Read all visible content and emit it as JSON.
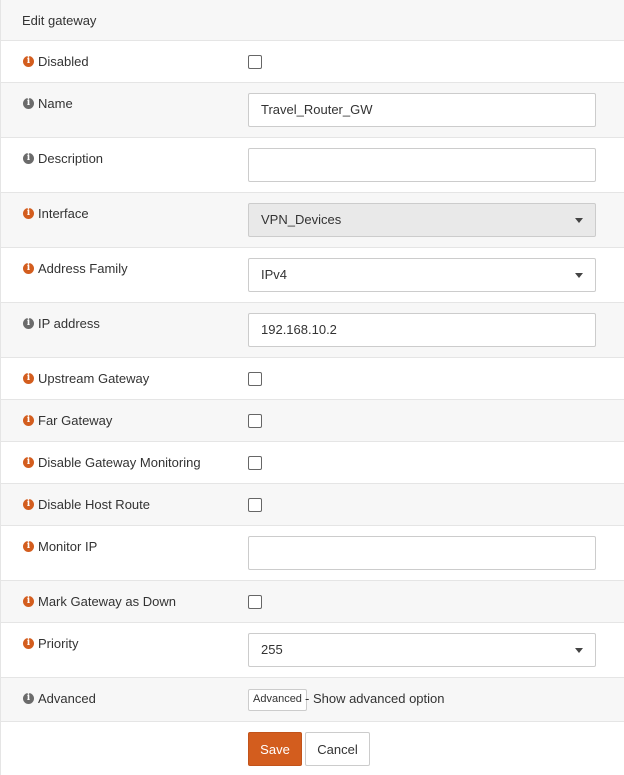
{
  "panel": {
    "title": "Edit gateway"
  },
  "fields": {
    "disabled": {
      "label": "Disabled",
      "checked": false
    },
    "name": {
      "label": "Name",
      "value": "Travel_Router_GW"
    },
    "description": {
      "label": "Description",
      "value": ""
    },
    "interface": {
      "label": "Interface",
      "value": "VPN_Devices"
    },
    "address_family": {
      "label": "Address Family",
      "value": "IPv4"
    },
    "ip_address": {
      "label": "IP address",
      "value": "192.168.10.2"
    },
    "upstream_gateway": {
      "label": "Upstream Gateway",
      "checked": false
    },
    "far_gateway": {
      "label": "Far Gateway",
      "checked": false
    },
    "disable_gateway_monitoring": {
      "label": "Disable Gateway Monitoring",
      "checked": false
    },
    "disable_host_route": {
      "label": "Disable Host Route",
      "checked": false
    },
    "monitor_ip": {
      "label": "Monitor IP",
      "value": ""
    },
    "mark_gateway_down": {
      "label": "Mark Gateway as Down",
      "checked": false
    },
    "priority": {
      "label": "Priority",
      "value": "255"
    },
    "advanced": {
      "label": "Advanced",
      "button_label": "Advanced",
      "description": "- Show advanced option"
    }
  },
  "actions": {
    "save_label": "Save",
    "cancel_label": "Cancel"
  },
  "colors": {
    "accent": "#d35d1e",
    "row_alt": "#f7f7f7",
    "border": "#e5e5e5"
  },
  "icons": {
    "required": "info-icon-orange",
    "optional": "info-icon-grey"
  }
}
